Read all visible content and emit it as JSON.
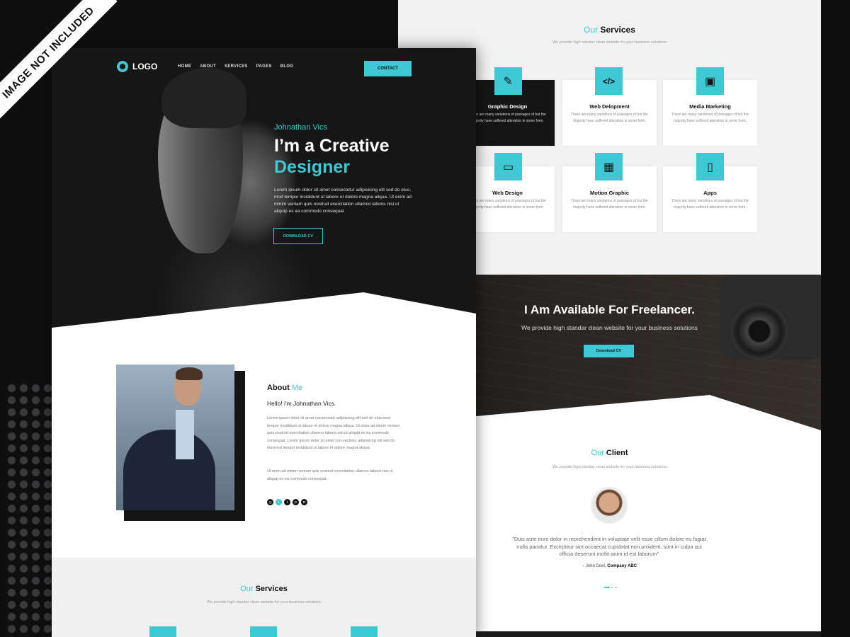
{
  "badge": "IMAGE NOT INCLUDED",
  "accent": "#3ec8d3",
  "header": {
    "logo": "LOGO",
    "nav": [
      "HOME",
      "ABOUT",
      "SERVICES",
      "PAGES",
      "BLOG"
    ],
    "contact": "CONTACT"
  },
  "hero": {
    "name": "Johnathan Vics",
    "title_line1": "I’m a Creative",
    "title_line2": "Designer",
    "description": "Lorem ipsum dolor sit amet consectetur adipisicing elit sed do eius-mod tempor incididunt ut labore et dolore magna aliqua. Ut enim ad minim veniam quis nostrud exercitation ullamco laboris nisi ut aliquip ex ea commodo consequat",
    "button": "DOWNLOAD CV"
  },
  "about": {
    "title": "About",
    "title_hl": "Me",
    "hello": "Hello! i'm Johnathan Vics.",
    "para1": "Lorem ipsum dolor sit amet consectetur adipisicing elit sed do eius-mod tempor incididunt ut labore et dolore magna aliqua. Ut enim ad minim veniam quis nostrud exercitation ullamco laboris nisi ut aliquip ex ea commodo consequat. Lorem ipsum dolor sit amet con-sectetur adipisicing elit sed do eiusmod tempor incididunt ut labore et dolore magna aliqua.",
    "para2": "Ut enim ad minim veniam quis nostrud exercitation ullamco laboris nisi ut aliquip ex ea commodo consequat",
    "socials": [
      "dribbble-icon",
      "facebook-icon",
      "twitter-icon",
      "pinterest-icon",
      "instagram-icon"
    ]
  },
  "services": {
    "title_hl": "Our",
    "title": "Services",
    "subtitle": "We provide high standar clean website for your business solutions",
    "card_text": "There are many variations of passages of but the majority have suffered alteration in some form.",
    "items": [
      {
        "label": "Graphic Design",
        "icon": "brush-icon",
        "glyph": "✎"
      },
      {
        "label": "Web Delopment",
        "icon": "code-icon",
        "glyph": "</>"
      },
      {
        "label": "Media Marketing",
        "icon": "briefcase-icon",
        "glyph": "▣"
      },
      {
        "label": "Web Design",
        "icon": "monitor-icon",
        "glyph": "▭"
      },
      {
        "label": "Motion Graphic",
        "icon": "film-icon",
        "glyph": "▦"
      },
      {
        "label": "Apps",
        "icon": "phone-icon",
        "glyph": "▯"
      }
    ]
  },
  "freelance": {
    "title": "I Am Available For Freelancer.",
    "subtitle": "We provide high standar clean website for your business solutions",
    "button": "Download CV"
  },
  "client": {
    "title_hl": "Our",
    "title": "Client",
    "subtitle": "We provide high standar clean website for your business solutions",
    "quote": "\"Duis aute irure dolor in reprehenderit in voluptate velit esse cillum dolore eu fugiat nulla pariatur. Excepteur sint occaecat cupidatat non proident, sunt in culpa qui officia deserunt mollit anim id est laborum\"",
    "author": "– John Doel,",
    "company": "Company ABC"
  }
}
